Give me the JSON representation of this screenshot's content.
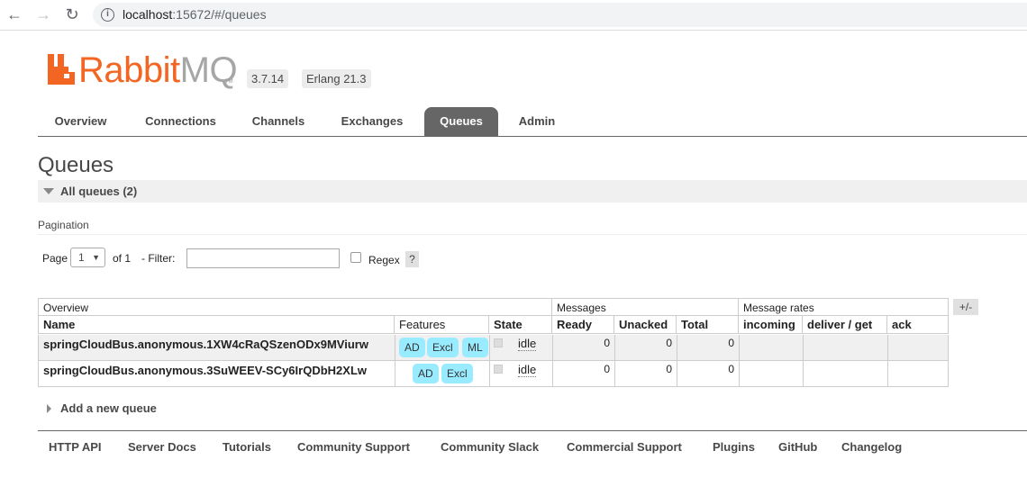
{
  "browser": {
    "url_host": "localhost",
    "url_rest": ":15672/#/queues"
  },
  "header": {
    "logo_rabbit": "Rabbit",
    "logo_mq": "MQ",
    "logo_tm": "TM",
    "version": "3.7.14",
    "erlang": "Erlang 21.3"
  },
  "tabs": [
    {
      "label": "Overview"
    },
    {
      "label": "Connections"
    },
    {
      "label": "Channels"
    },
    {
      "label": "Exchanges"
    },
    {
      "label": "Queues",
      "active": true
    },
    {
      "label": "Admin"
    }
  ],
  "page": {
    "title": "Queues",
    "section": "All queues (2)",
    "pagination_label": "Pagination",
    "page_label": "Page",
    "page_value": "1",
    "of_label": "of 1",
    "filter_label": "- Filter:",
    "filter_value": "",
    "regex_label": "Regex",
    "help_label": "?"
  },
  "table": {
    "groups": {
      "overview": "Overview",
      "messages": "Messages",
      "rates": "Message rates"
    },
    "columns": {
      "name": "Name",
      "features": "Features",
      "state": "State",
      "ready": "Ready",
      "unacked": "Unacked",
      "total": "Total",
      "incoming": "incoming",
      "deliver_get": "deliver / get",
      "ack": "ack"
    },
    "plusminus": "+/-",
    "rows": [
      {
        "name": "springCloudBus.anonymous.1XW4cRaQSzenODx9MViurw",
        "features": [
          "AD",
          "Excl",
          "ML"
        ],
        "state": "idle",
        "ready": "0",
        "unacked": "0",
        "total": "0"
      },
      {
        "name": "springCloudBus.anonymous.3SuWEEV-SCy6IrQDbH2XLw",
        "features": [
          "AD",
          "Excl"
        ],
        "state": "idle",
        "ready": "0",
        "unacked": "0",
        "total": "0"
      }
    ]
  },
  "add_queue": "Add a new queue",
  "footer": {
    "links": [
      "HTTP API",
      "Server Docs",
      "Tutorials",
      "Community Support",
      "Community Slack",
      "Commercial Support",
      "Plugins",
      "GitHub",
      "Changelog"
    ]
  },
  "colors": {
    "brand_orange": "#f26522",
    "tab_active": "#666666",
    "feature_badge": "#99ebff"
  }
}
